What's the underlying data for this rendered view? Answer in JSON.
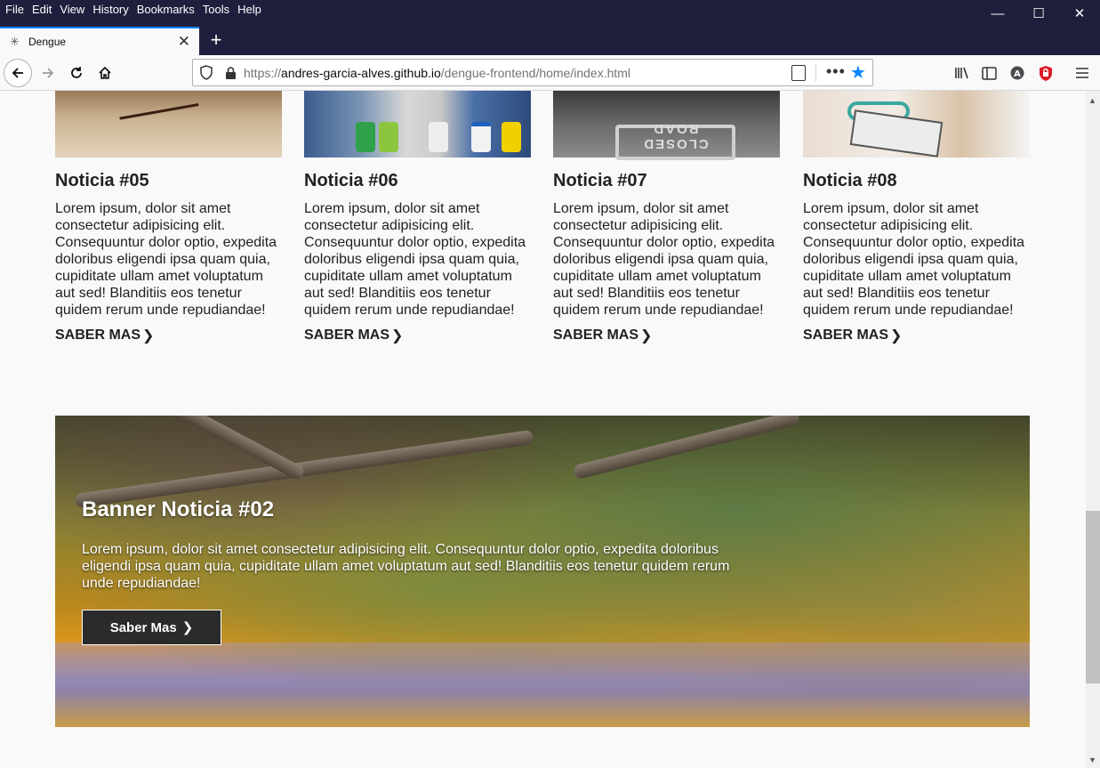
{
  "menu": [
    "File",
    "Edit",
    "View",
    "History",
    "Bookmarks",
    "Tools",
    "Help"
  ],
  "window_controls": {
    "minimize": "—",
    "maximize": "☐",
    "close": "✕"
  },
  "tab": {
    "title": "Dengue",
    "close": "✕",
    "new_tab": "+"
  },
  "address": {
    "url_prefix": "https://",
    "url_host": "andres-garcia-alves.github.io",
    "url_path": "/dengue-frontend/home/index.html"
  },
  "news": [
    {
      "title": "Noticia #05",
      "body": "Lorem ipsum, dolor sit amet consectetur adipisicing elit. Consequuntur dolor optio, expedita doloribus eligendi ipsa quam quia, cupiditate ullam amet voluptatum aut sed! Blanditiis eos tenetur quidem rerum unde repudiandae!",
      "link": "SABER MAS"
    },
    {
      "title": "Noticia #06",
      "body": "Lorem ipsum, dolor sit amet consectetur adipisicing elit. Consequuntur dolor optio, expedita doloribus eligendi ipsa quam quia, cupiditate ullam amet voluptatum aut sed! Blanditiis eos tenetur quidem rerum unde repudiandae!",
      "link": "SABER MAS"
    },
    {
      "title": "Noticia #07",
      "body": "Lorem ipsum, dolor sit amet consectetur adipisicing elit. Consequuntur dolor optio, expedita doloribus eligendi ipsa quam quia, cupiditate ullam amet voluptatum aut sed! Blanditiis eos tenetur quidem rerum unde repudiandae!",
      "link": "SABER MAS"
    },
    {
      "title": "Noticia #08",
      "body": "Lorem ipsum, dolor sit amet consectetur adipisicing elit. Consequuntur dolor optio, expedita doloribus eligendi ipsa quam quia, cupiditate ullam amet voluptatum aut sed! Blanditiis eos tenetur quidem rerum unde repudiandae!",
      "link": "SABER MAS"
    }
  ],
  "news_images": [
    "mosquito-on-skin",
    "fumigation-workers",
    "closed-road-sign",
    "doctor-stethoscope"
  ],
  "img3_sign": "CLOSED ROAD",
  "banner": {
    "title": "Banner Noticia #02",
    "body": "Lorem ipsum, dolor sit amet consectetur adipisicing elit. Consequuntur dolor optio, expedita doloribus eligendi ipsa quam quia, cupiditate ullam amet voluptatum aut sed! Blanditiis eos tenetur quidem rerum unde repudiandae!",
    "button": "Saber Mas"
  },
  "colors": {
    "titlebar": "#1f1f3d",
    "accent": "#0a84ff",
    "page_bg": "#f9f9fa",
    "text": "#222222"
  }
}
